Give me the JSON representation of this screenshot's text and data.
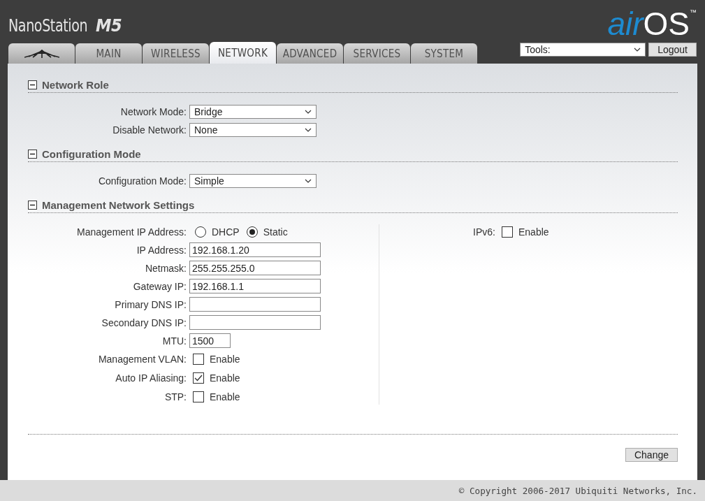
{
  "header": {
    "product": "NanoStation",
    "model": "M5",
    "brand": {
      "air": "air",
      "os": "OS",
      "tm": "™"
    }
  },
  "tabs": [
    {
      "kind": "logo",
      "selected": false
    },
    {
      "kind": "text",
      "label": "MAIN",
      "selected": false
    },
    {
      "kind": "text",
      "label": "WIRELESS",
      "selected": false
    },
    {
      "kind": "text",
      "label": "NETWORK",
      "selected": true
    },
    {
      "kind": "text",
      "label": "ADVANCED",
      "selected": false
    },
    {
      "kind": "text",
      "label": "SERVICES",
      "selected": false
    },
    {
      "kind": "text",
      "label": "SYSTEM",
      "selected": false
    }
  ],
  "tools": {
    "value": "Tools:"
  },
  "logout": "Logout",
  "sections": [
    {
      "title": "Network Role",
      "expanded": true,
      "left": [
        {
          "kind": "select",
          "label": "Network Mode:",
          "value": "Bridge"
        },
        {
          "kind": "select",
          "label": "Disable Network:",
          "value": "None"
        }
      ]
    },
    {
      "title": "Configuration Mode",
      "expanded": true,
      "left": [
        {
          "kind": "select",
          "label": "Configuration Mode:",
          "value": "Simple"
        }
      ]
    },
    {
      "title": "Management Network Settings",
      "expanded": true,
      "left": [
        {
          "kind": "radio",
          "label": "Management IP Address:",
          "options": [
            {
              "label": "DHCP",
              "selected": false
            },
            {
              "label": "Static",
              "selected": true
            }
          ]
        },
        {
          "kind": "text",
          "label": "IP Address:",
          "value": "192.168.1.20"
        },
        {
          "kind": "text",
          "label": "Netmask:",
          "value": "255.255.255.0"
        },
        {
          "kind": "text",
          "label": "Gateway IP:",
          "value": "192.168.1.1"
        },
        {
          "kind": "text",
          "label": "Primary DNS IP:"
        },
        {
          "kind": "text",
          "label": "Secondary DNS IP:"
        },
        {
          "kind": "short",
          "label": "MTU:",
          "value": "1500"
        },
        {
          "kind": "checkbox",
          "label": "Management VLAN:",
          "option": "Enable",
          "checked": false
        },
        {
          "kind": "checkbox",
          "label": "Auto IP Aliasing:",
          "option": "Enable",
          "checked": true
        },
        {
          "kind": "checkbox",
          "label": "STP:",
          "option": "Enable",
          "checked": false
        }
      ],
      "right": [
        {
          "kind": "checkbox",
          "label": "IPv6:",
          "option": "Enable",
          "checked": false
        }
      ]
    }
  ],
  "change": "Change",
  "footer": "© Copyright 2006-2017 Ubiquiti Networks, Inc."
}
